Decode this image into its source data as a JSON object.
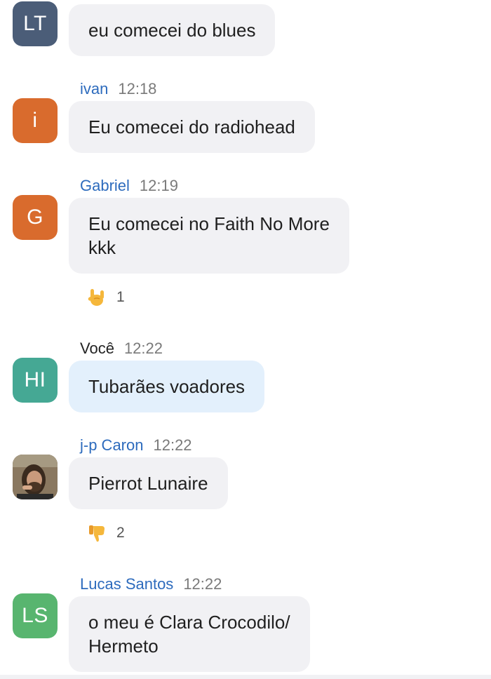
{
  "messages": [
    {
      "avatar_initials": "LT",
      "avatar_color": "#4b5d78",
      "text_lines": [
        "eu comecei do blues"
      ]
    },
    {
      "sender": "ivan",
      "time": "12:18",
      "avatar_initials": "i",
      "avatar_color": "#d96b2d",
      "text_lines": [
        "Eu comecei do radiohead"
      ]
    },
    {
      "sender": "Gabriel",
      "time": "12:19",
      "avatar_initials": "G",
      "avatar_color": "#d96b2d",
      "text_lines": [
        "Eu comecei no Faith No More",
        "kkk"
      ],
      "reaction": {
        "emoji": "love-you-gesture-icon",
        "count": "1"
      }
    },
    {
      "sender": "Você",
      "time": "12:22",
      "avatar_initials": "HI",
      "avatar_color": "#45a894",
      "text_lines": [
        "Tubarães voadores"
      ]
    },
    {
      "sender": "j-p Caron",
      "time": "12:22",
      "avatar_icon": "user-photo",
      "text_lines": [
        "Pierrot Lunaire"
      ],
      "reaction": {
        "emoji": "thumbs-down-icon",
        "count": "2"
      }
    },
    {
      "sender": "Lucas Santos",
      "time": "12:22",
      "avatar_initials": "LS",
      "avatar_color": "#58b56f",
      "text_lines": [
        "o meu é Clara Crocodilo/",
        "Hermeto"
      ]
    }
  ]
}
